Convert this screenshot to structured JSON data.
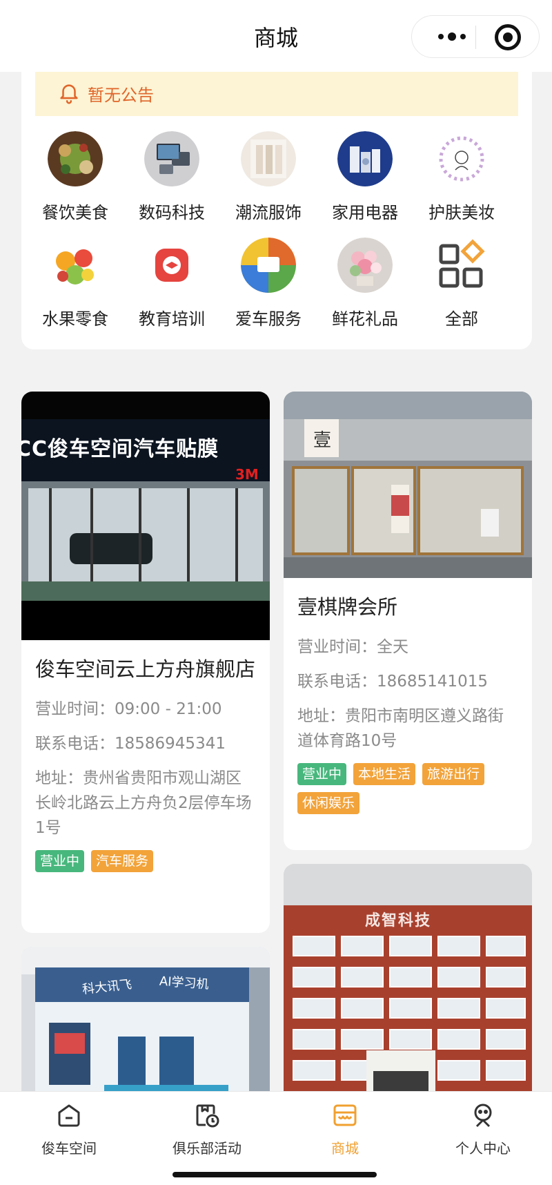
{
  "header": {
    "title": "商城"
  },
  "notice": {
    "text": "暂无公告",
    "icon": "bell-icon"
  },
  "categories": [
    {
      "label": "餐饮美食",
      "icon": "food-icon"
    },
    {
      "label": "数码科技",
      "icon": "digital-icon"
    },
    {
      "label": "潮流服饰",
      "icon": "fashion-icon"
    },
    {
      "label": "家用电器",
      "icon": "appliance-icon"
    },
    {
      "label": "护肤美妆",
      "icon": "cosmetics-icon"
    },
    {
      "label": "水果零食",
      "icon": "fruit-icon"
    },
    {
      "label": "教育培训",
      "icon": "education-icon"
    },
    {
      "label": "爱车服务",
      "icon": "car-service-icon"
    },
    {
      "label": "鲜花礼品",
      "icon": "flower-icon"
    },
    {
      "label": "全部",
      "icon": "grid-all-icon"
    }
  ],
  "stores": [
    {
      "name": "俊车空间云上方舟旗舰店",
      "image_sign": "CC俊车空间汽车贴膜",
      "image_sign_badge": "3M",
      "hours": "营业时间：09:00 - 21:00",
      "phone": "联系电话：18586945341",
      "address": "地址：贵州省贵阳市观山湖区长岭北路云上方舟负2层停车场1号",
      "tags": [
        {
          "text": "营业中",
          "color": "green"
        },
        {
          "text": "汽车服务",
          "color": "orange"
        }
      ]
    },
    {
      "name": "壹棋牌会所",
      "image_sign": "壹",
      "hours": "营业时间：全天",
      "phone": "联系电话：18685141015",
      "address": "地址：贵阳市南明区遵义路街道体育路10号",
      "tags": [
        {
          "text": "营业中",
          "color": "green"
        },
        {
          "text": "本地生活",
          "color": "orange"
        },
        {
          "text": "旅游出行",
          "color": "orange"
        },
        {
          "text": "休闲娱乐",
          "color": "orange"
        }
      ]
    },
    {
      "image_sign": "科大讯飞",
      "image_sign2": "AI学习机"
    },
    {
      "image_sign": "成智科技"
    }
  ],
  "tabbar": [
    {
      "label": "俊车空间",
      "icon": "home-icon",
      "active": false
    },
    {
      "label": "俱乐部活动",
      "icon": "calendar-clock-icon",
      "active": false
    },
    {
      "label": "商城",
      "icon": "shop-icon",
      "active": true
    },
    {
      "label": "个人中心",
      "icon": "user-icon",
      "active": false
    }
  ],
  "colors": {
    "accent": "#f0a030",
    "green_tag": "#48b77d",
    "orange_tag": "#f2a33a",
    "notice_bg": "#fcf4d4",
    "notice_text": "#e0652a"
  }
}
